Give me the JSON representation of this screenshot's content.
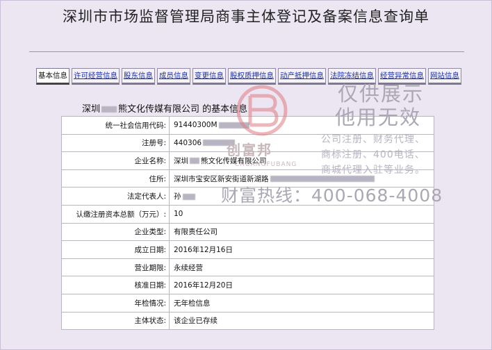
{
  "page": {
    "title": "深圳市市场监督管理局商事主体登记及备案信息查询单"
  },
  "tabs": [
    {
      "label": "基本信息",
      "active": true
    },
    {
      "label": "许可经营信息",
      "active": false
    },
    {
      "label": "股东信息",
      "active": false
    },
    {
      "label": "成员信息",
      "active": false
    },
    {
      "label": "变更信息",
      "active": false
    },
    {
      "label": "股权质押信息",
      "active": false
    },
    {
      "label": "动产抵押信息",
      "active": false
    },
    {
      "label": "法院冻结信息",
      "active": false
    },
    {
      "label": "经营异常信息",
      "active": false
    },
    {
      "label": "网站信息",
      "active": false
    }
  ],
  "company": {
    "name_prefix": "深圳",
    "name_suffix": "熊文化传媒有限公司",
    "heading_suffix": "的基本信息"
  },
  "rows": [
    {
      "label": "统一社会信用代码:",
      "value": "91440300M"
    },
    {
      "label": "注册号:",
      "value": "440306"
    },
    {
      "label": "企业名称:",
      "value": "深圳"
    },
    {
      "label": "住所:",
      "value": "深圳市宝安区新安街道新湖路"
    },
    {
      "label": "法定代表人:",
      "value": "孙"
    },
    {
      "label": "认缴注册资本总额（万元）:",
      "value": "10"
    },
    {
      "label": "企业类型:",
      "value": "有限责任公司"
    },
    {
      "label": "成立日期:",
      "value": "2016年12月16日"
    },
    {
      "label": "营业期限:",
      "value": "永续经营"
    },
    {
      "label": "核准日期:",
      "value": "2016年12月20日"
    },
    {
      "label": "年检情况:",
      "value": "无年检信息"
    },
    {
      "label": "主体状态:",
      "value": "该企业已存续"
    }
  ],
  "watermark": {
    "brand": "创富邦",
    "brand_latin": "CHUANGFUBANG",
    "line1": "仅供展示",
    "line2": "他用无效",
    "services": "公司注册、财务代理、\n商标注册、400电话、\n商城代理入驻等业务。",
    "hotline": "财富热线：400-068-4008",
    "brand_color": "#d9535a"
  }
}
